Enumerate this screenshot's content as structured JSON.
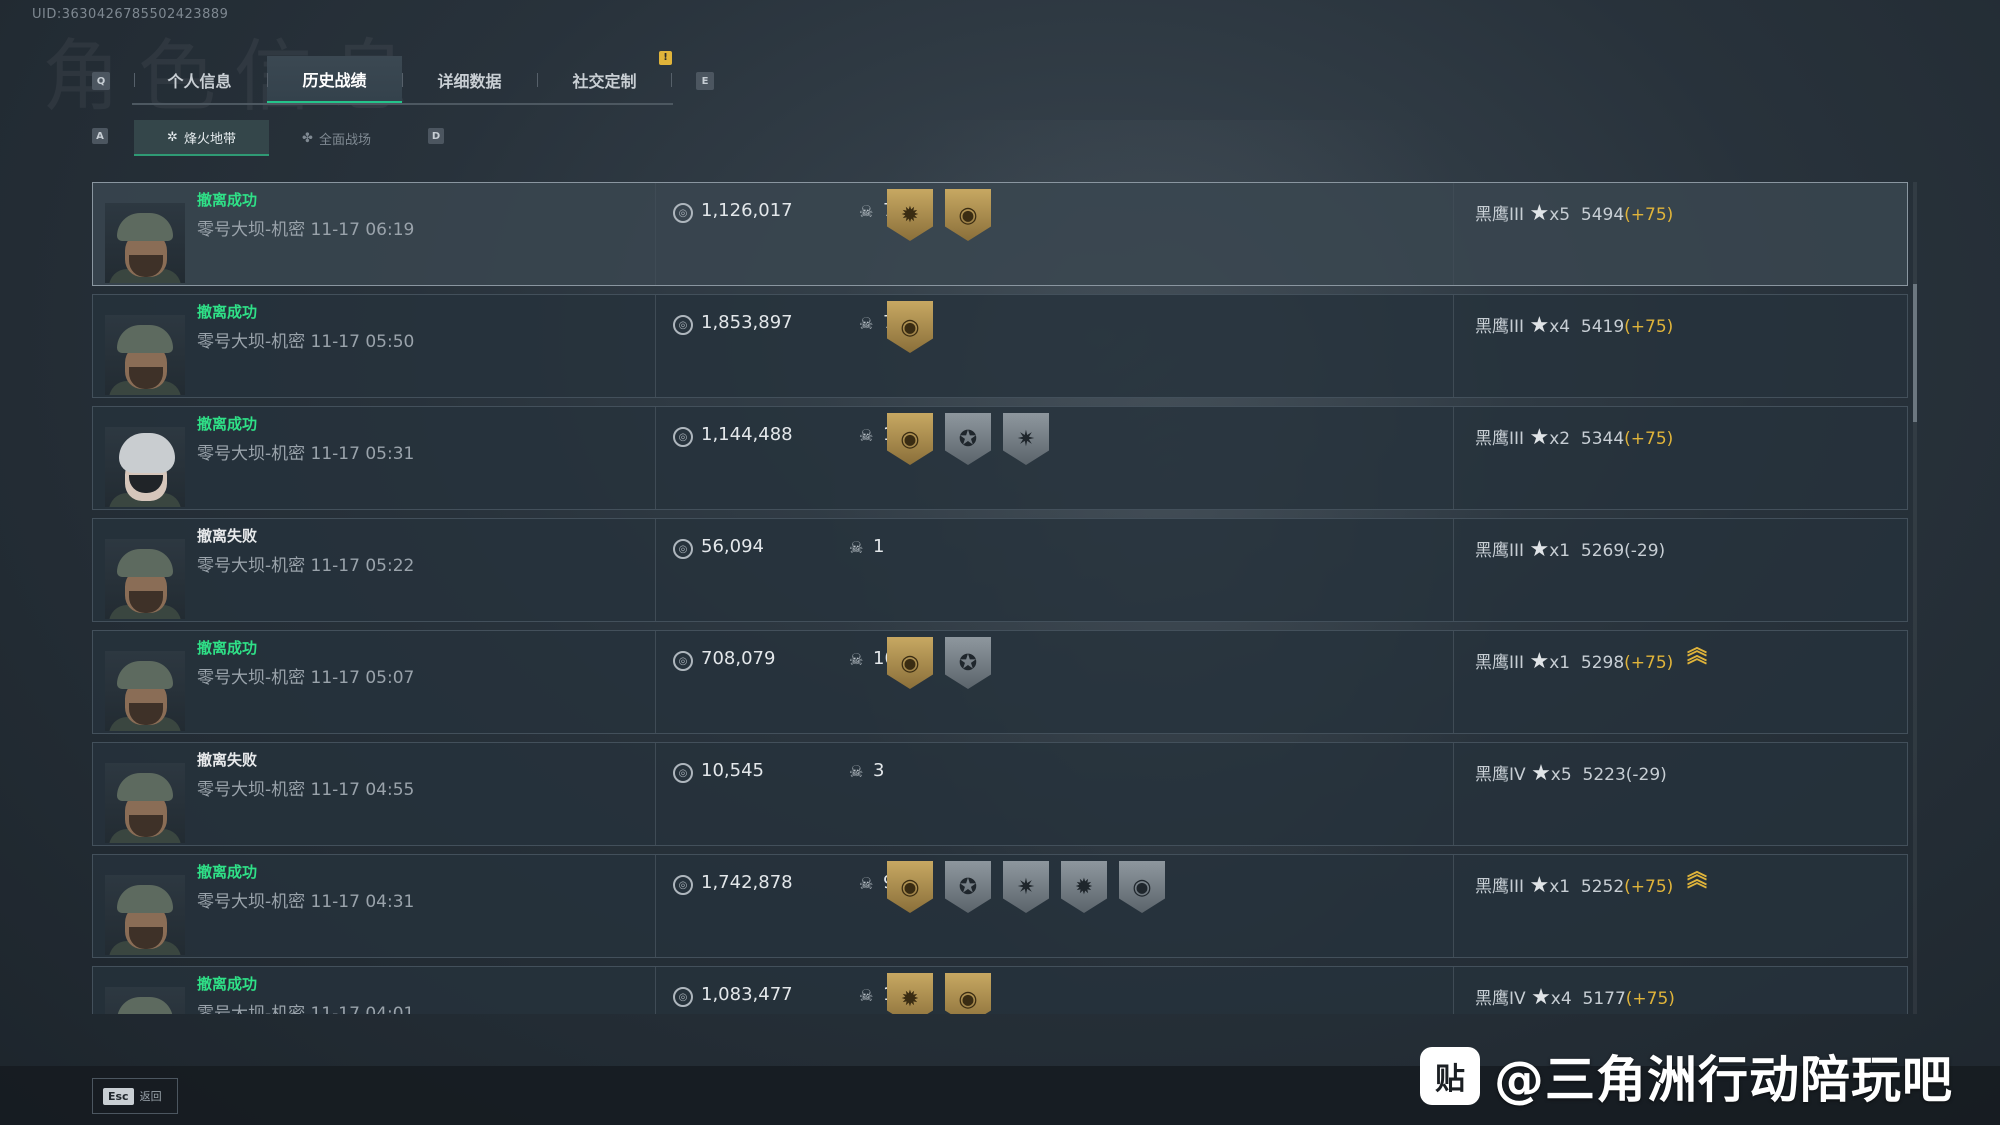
{
  "uid": "UID:3630426785502423889",
  "page_title": "角色信息",
  "tabs": {
    "prev_key": "Q",
    "next_key": "E",
    "items": [
      {
        "label": "个人信息",
        "active": false
      },
      {
        "label": "历史战绩",
        "active": true
      },
      {
        "label": "详细数据",
        "active": false
      },
      {
        "label": "社交定制",
        "active": false
      }
    ],
    "notification": "!"
  },
  "subtabs": {
    "prev_key": "A",
    "next_key": "D",
    "items": [
      {
        "label": "烽火地带",
        "active": true
      },
      {
        "label": "全面战场",
        "active": false
      }
    ]
  },
  "rows": [
    {
      "status": "撤离成功",
      "map_time": "零号大坝-机密 11-17 06:19",
      "value": "1,126,017",
      "kills": "7",
      "badges": [
        "gold",
        "gold"
      ],
      "rank": "黑鹰III",
      "stars": "x5",
      "score": "5494",
      "delta": "(+75)",
      "chevron": false
    },
    {
      "status": "撤离成功",
      "map_time": "零号大坝-机密 11-17 05:50",
      "value": "1,853,897",
      "kills": "7",
      "badges": [
        "gold"
      ],
      "rank": "黑鹰III",
      "stars": "x4",
      "score": "5419",
      "delta": "(+75)",
      "chevron": false
    },
    {
      "status": "撤离成功",
      "map_time": "零号大坝-机密 11-17 05:31",
      "value": "1,144,488",
      "kills": "15",
      "badges": [
        "gold",
        "silver",
        "silver"
      ],
      "rank": "黑鹰III",
      "stars": "x2",
      "score": "5344",
      "delta": "(+75)",
      "chevron": false
    },
    {
      "status": "撤离失败",
      "map_time": "零号大坝-机密 11-17 05:22",
      "value": "56,094",
      "kills": "1",
      "badges": [],
      "rank": "黑鹰III",
      "stars": "x1",
      "score": "5269",
      "delta": "(-29)",
      "chevron": false
    },
    {
      "status": "撤离成功",
      "map_time": "零号大坝-机密 11-17 05:07",
      "value": "708,079",
      "kills": "10",
      "badges": [
        "gold",
        "silver"
      ],
      "rank": "黑鹰III",
      "stars": "x1",
      "score": "5298",
      "delta": "(+75)",
      "chevron": true
    },
    {
      "status": "撤离失败",
      "map_time": "零号大坝-机密 11-17 04:55",
      "value": "10,545",
      "kills": "3",
      "badges": [],
      "rank": "黑鹰IV",
      "stars": "x5",
      "score": "5223",
      "delta": "(-29)",
      "chevron": false
    },
    {
      "status": "撤离成功",
      "map_time": "零号大坝-机密 11-17 04:31",
      "value": "1,742,878",
      "kills": "9",
      "badges": [
        "gold",
        "silver",
        "silver",
        "silver",
        "silver"
      ],
      "rank": "黑鹰III",
      "stars": "x1",
      "score": "5252",
      "delta": "(+75)",
      "chevron": true
    },
    {
      "status": "撤离成功",
      "map_time": "零号大坝-机密 11-17 04:01",
      "value": "1,083,477",
      "kills": "10",
      "badges": [
        "gold",
        "gold"
      ],
      "rank": "黑鹰IV",
      "stars": "x4",
      "score": "5177",
      "delta": "(+75)",
      "chevron": false
    }
  ],
  "footer": {
    "esc_key": "Esc",
    "back_label": "返回"
  },
  "watermark": {
    "logo": "贴",
    "text": "@三角洲行动陪玩吧"
  },
  "colors": {
    "success": "#2fe087",
    "accent": "#24c48a",
    "gold": "#e0b43a"
  }
}
